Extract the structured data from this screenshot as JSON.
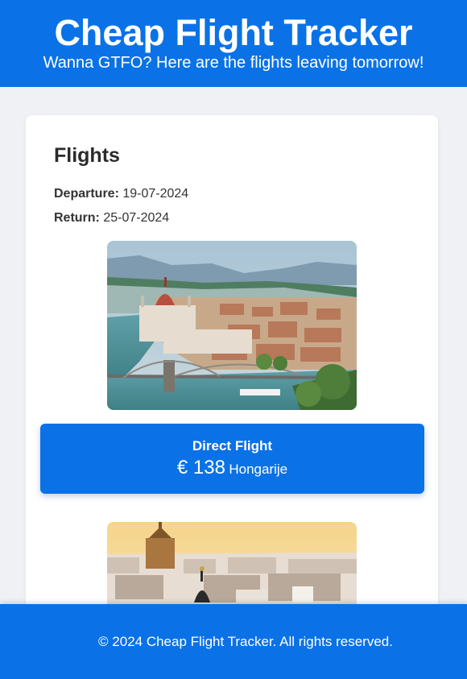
{
  "header": {
    "title": "Cheap Flight Tracker",
    "tagline": "Wanna GTFO? Here are the flights leaving tomorrow!"
  },
  "flights": {
    "heading": "Flights",
    "departure_label": "Departure:",
    "departure_date": "19-07-2024",
    "return_label": "Return:",
    "return_date": "25-07-2024",
    "items": [
      {
        "type": "Direct Flight",
        "price": "€ 138",
        "destination": "Hongarije"
      }
    ]
  },
  "footer": {
    "text": "© 2024 Cheap Flight Tracker. All rights reserved."
  },
  "colors": {
    "primary": "#0a72e6",
    "background": "#eff1f5",
    "card": "#ffffff"
  }
}
